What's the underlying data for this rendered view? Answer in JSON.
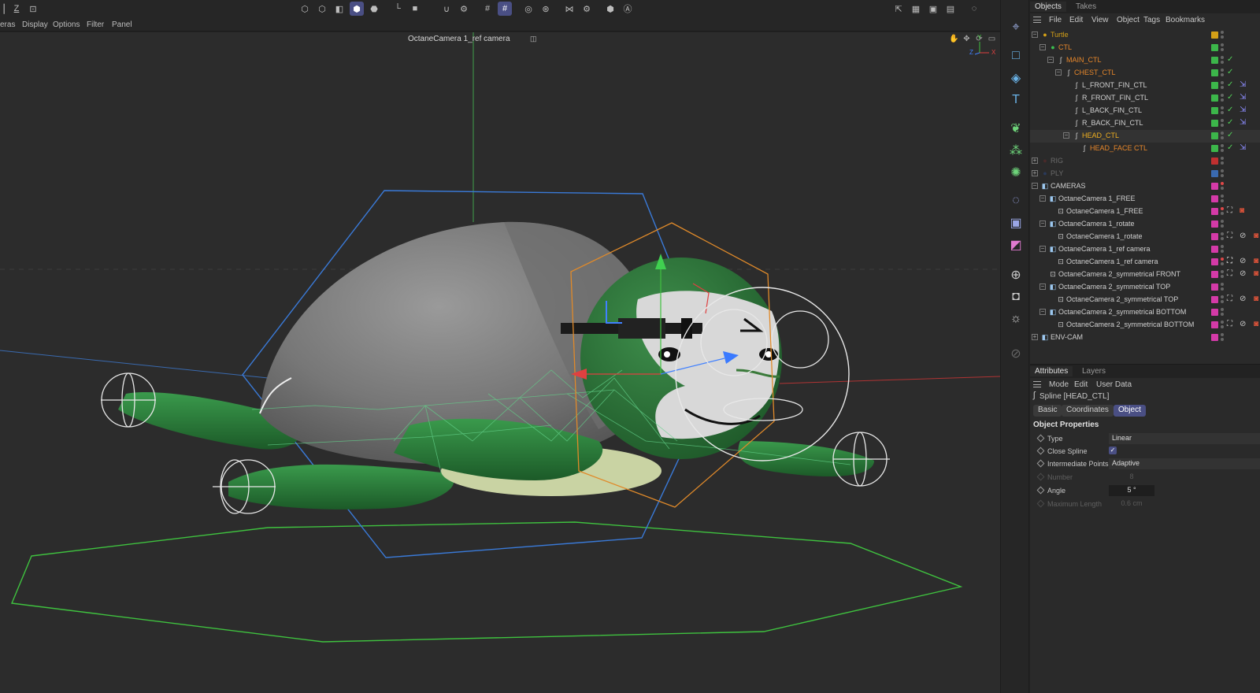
{
  "toolbar": {
    "left_label_z": "Z",
    "hud_colors": {
      "x": "#e04040",
      "y": "#40c040",
      "z": "#4080ff"
    }
  },
  "viewport_menu": [
    "eras",
    "Display",
    "Options",
    "Filter",
    "Panel"
  ],
  "viewport": {
    "camera_title": "OctaneCamera 1_ref camera",
    "axis_labels": {
      "y": "Y",
      "z": "Z",
      "x": "X"
    }
  },
  "object_manager": {
    "tabs": [
      "Objects",
      "Takes"
    ],
    "menu": [
      "File",
      "Edit",
      "View",
      "Object",
      "Tags",
      "Bookmarks"
    ],
    "rows": [
      {
        "label": "Turtle",
        "color": "#d4a017",
        "tag": "#d4a017"
      },
      {
        "label": "CTL",
        "color": "#e7872a",
        "tag": "#3cb64a"
      },
      {
        "label": "MAIN_CTL",
        "color": "#e7872a",
        "tag": "#3cb64a"
      },
      {
        "label": "CHEST_CTL",
        "color": "#e7872a",
        "tag": "#3cb64a"
      },
      {
        "label": "L_FRONT_FIN_CTL",
        "color": "#d0d0d0",
        "tag": "#3cb64a"
      },
      {
        "label": "R_FRONT_FIN_CTL",
        "color": "#d0d0d0",
        "tag": "#3cb64a"
      },
      {
        "label": "L_BACK_FIN_CTL",
        "color": "#d0d0d0",
        "tag": "#3cb64a"
      },
      {
        "label": "R_BACK_FIN_CTL",
        "color": "#d0d0d0",
        "tag": "#3cb64a"
      },
      {
        "label": "HEAD_CTL",
        "color": "#f0b020",
        "tag": "#3cb64a"
      },
      {
        "label": "HEAD_FACE CTL",
        "color": "#e7872a",
        "tag": "#3cb64a"
      },
      {
        "label": "RIG",
        "color": "#6a6a6a",
        "tag": "#c03030"
      },
      {
        "label": "PLY",
        "color": "#6a6a6a",
        "tag": "#3a6ab0"
      },
      {
        "label": "CAMERAS",
        "color": "#d0d0d0",
        "tag": "#d43aa8"
      },
      {
        "label": "OctaneCamera 1_FREE",
        "color": "#d0d0d0",
        "tag": "#d43aa8"
      },
      {
        "label": "OctaneCamera 1_FREE",
        "color": "#d0d0d0",
        "tag": "#d43aa8"
      },
      {
        "label": "OctaneCamera 1_rotate",
        "color": "#d0d0d0",
        "tag": "#d43aa8"
      },
      {
        "label": "OctaneCamera 1_rotate",
        "color": "#d0d0d0",
        "tag": "#d43aa8"
      },
      {
        "label": "OctaneCamera 1_ref camera",
        "color": "#d0d0d0",
        "tag": "#d43aa8"
      },
      {
        "label": "OctaneCamera 1_ref camera",
        "color": "#d0d0d0",
        "tag": "#d43aa8"
      },
      {
        "label": "OctaneCamera 2_symmetrical FRONT",
        "color": "#d0d0d0",
        "tag": "#d43aa8"
      },
      {
        "label": "OctaneCamera 2_symmetrical TOP",
        "color": "#d0d0d0",
        "tag": "#d43aa8"
      },
      {
        "label": "OctaneCamera 2_symmetrical TOP",
        "color": "#d0d0d0",
        "tag": "#d43aa8"
      },
      {
        "label": "OctaneCamera 2_symmetrical BOTTOM",
        "color": "#d0d0d0",
        "tag": "#d43aa8"
      },
      {
        "label": "OctaneCamera 2_symmetrical BOTTOM",
        "color": "#d0d0d0",
        "tag": "#d43aa8"
      },
      {
        "label": "ENV-CAM",
        "color": "#d0d0d0",
        "tag": "#d43aa8"
      }
    ]
  },
  "attributes": {
    "tabs": [
      "Attributes",
      "Layers"
    ],
    "menu": [
      "Mode",
      "Edit",
      "User Data"
    ],
    "object_title": "Spline [HEAD_CTL]",
    "buttons": [
      "Basic",
      "Coordinates",
      "Object"
    ],
    "section": "Object Properties",
    "props": {
      "type_label": "Type",
      "type_value": "Linear",
      "close_label": "Close Spline",
      "close_value": "✓",
      "interp_label": "Intermediate Points",
      "interp_value": "Adaptive",
      "number_label": "Number",
      "number_value": "8",
      "angle_label": "Angle",
      "angle_value": "5 °",
      "maxlen_label": "Maximum Length",
      "maxlen_value": "0.6 cm"
    }
  }
}
